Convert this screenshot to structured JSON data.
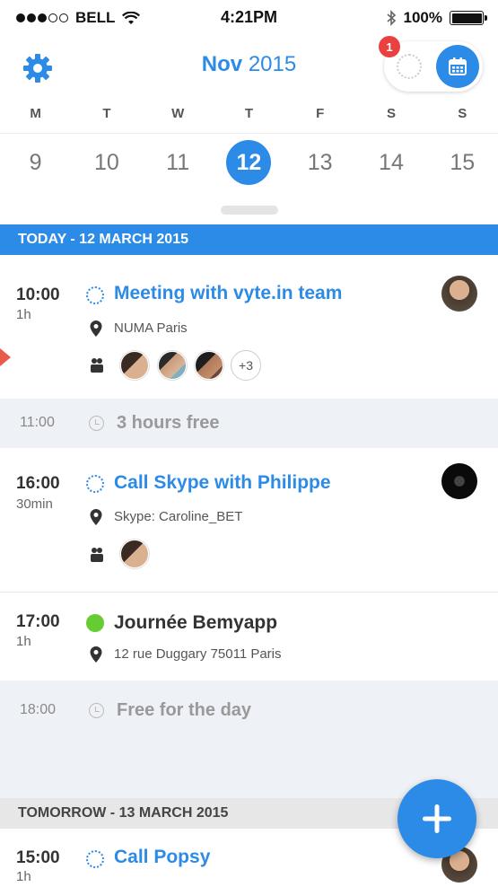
{
  "status_bar": {
    "carrier": "BELL",
    "time": "4:21PM",
    "battery": "100%",
    "signal_bars_filled": 3,
    "signal_bars_total": 5
  },
  "header": {
    "month": "Nov",
    "year": "2015",
    "notification_count": "1",
    "accent_color": "#2c8be6"
  },
  "week": {
    "weekdays": [
      "M",
      "T",
      "W",
      "T",
      "F",
      "S",
      "S"
    ],
    "dates": [
      "9",
      "10",
      "11",
      "12",
      "13",
      "14",
      "15"
    ],
    "selected_date": "12"
  },
  "sections": {
    "today": "TODAY - 12 MARCH 2015",
    "tomorrow": "TOMORROW - 13 MARCH 2015"
  },
  "events": [
    {
      "time": "10:00",
      "duration": "1h",
      "title": "Meeting with vyte.in team",
      "location": "NUMA Paris",
      "more_attendees": "+3"
    },
    {
      "time": "16:00",
      "duration": "30min",
      "title": "Call Skype with Philippe",
      "location": "Skype: Caroline_BET"
    },
    {
      "time": "17:00",
      "duration": "1h",
      "title": "Journée Bemyapp",
      "location": "12 rue Duggary 75011 Paris",
      "color": "#66cc33"
    },
    {
      "time": "15:00",
      "duration": "1h",
      "title": "Call Popsy"
    }
  ],
  "free_slots": [
    {
      "time": "11:00",
      "label": "3 hours free"
    },
    {
      "time": "18:00",
      "label": "Free for the day"
    }
  ],
  "icons": {
    "settings": "gear-icon",
    "calendar": "calendar-icon",
    "add": "plus-icon",
    "location": "map-pin-icon",
    "attendees": "people-icon",
    "free": "clock-icon"
  }
}
